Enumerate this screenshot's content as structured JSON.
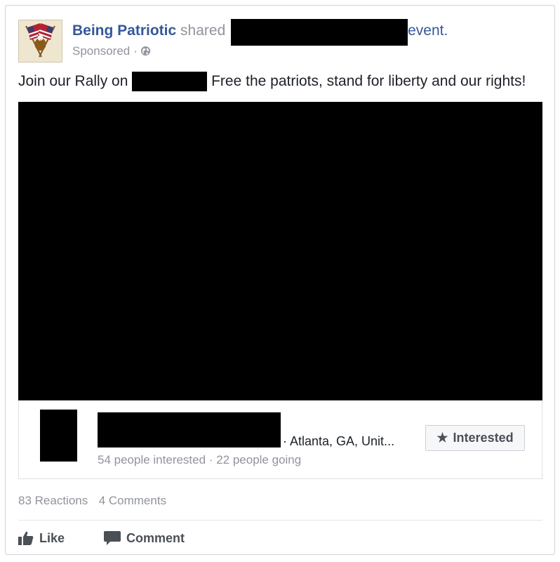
{
  "post": {
    "page_name": "Being Patriotic",
    "shared_word": "shared",
    "event_word": "event.",
    "sponsored_label": "Sponsored",
    "separator": "·",
    "text_before": "Join our Rally on",
    "text_after": "Free the patriots, stand for liberty and our rights!"
  },
  "event": {
    "location": "· Atlanta, GA, Unit...",
    "interested_count": "54 people interested",
    "stats_separator": "·",
    "going_count": "22 people going",
    "interested_button": "Interested",
    "interested_icon": "star-icon"
  },
  "engagement": {
    "reactions": "83 Reactions",
    "comments": "4 Comments"
  },
  "actions": {
    "like_label": "Like",
    "like_icon": "thumbs-up-icon",
    "comment_label": "Comment",
    "comment_icon": "speech-bubble-icon"
  },
  "colors": {
    "link_blue": "#365899",
    "muted_gray": "#90949c",
    "text": "#1d2129"
  }
}
